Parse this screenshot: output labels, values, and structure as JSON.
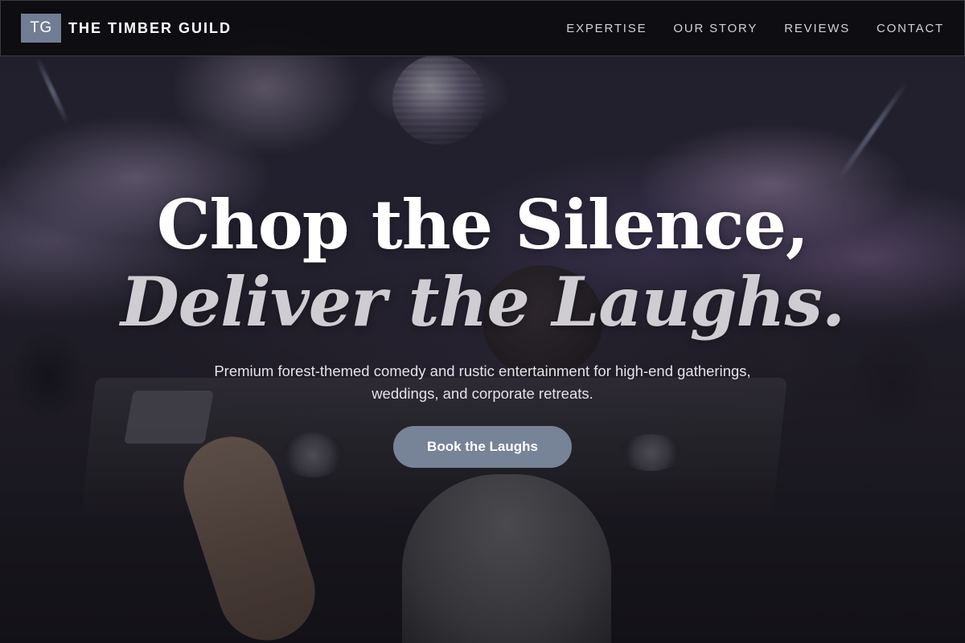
{
  "brand": {
    "mark": "TG",
    "name": "THE TIMBER GUILD"
  },
  "nav": {
    "items": [
      {
        "label": "EXPERTISE"
      },
      {
        "label": "OUR STORY"
      },
      {
        "label": "REVIEWS"
      },
      {
        "label": "CONTACT"
      }
    ]
  },
  "hero": {
    "headline_line1": "Chop the Silence,",
    "headline_line2": "Deliver the Laughs.",
    "subtitle": "Premium forest-themed comedy and rustic entertainment for high-end gatherings, weddings, and corporate retreats.",
    "cta_label": "Book the Laughs"
  },
  "colors": {
    "brand_mark_bg": "#717d92",
    "cta_bg": "#778396",
    "nav_bg": "#0c0c10"
  }
}
